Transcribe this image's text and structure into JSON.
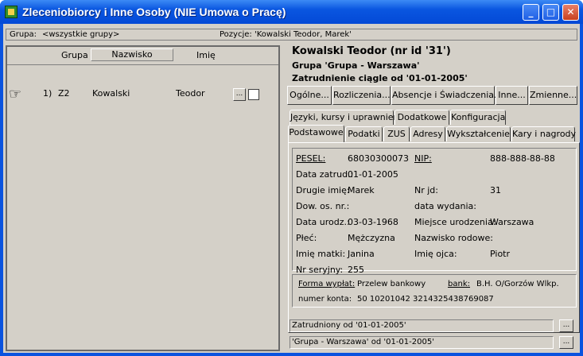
{
  "window": {
    "title": "Zleceniobiorcy i Inne Osoby (NIE Umowa o Pracę)",
    "min_label": "_",
    "max_label": "□",
    "close_label": "✕"
  },
  "groupbar": {
    "group_label": "Grupa:",
    "group_value": "<wszystkie grupy>",
    "position_label": "Pozycje:",
    "position_value": "'Kowalski Teodor, Marek'"
  },
  "list": {
    "col_group": "Grupa",
    "col_surname": "Nazwisko",
    "col_name": "Imię",
    "rows": [
      {
        "num": "1)",
        "group": "Z2",
        "surname": "Kowalski",
        "name": "Teodor",
        "dots": "..."
      }
    ]
  },
  "detail": {
    "header_name": "Kowalski Teodor (nr id '31')",
    "header_group": "Grupa 'Grupa - Warszawa'",
    "header_employment": "Zatrudnienie ciągle od '01-01-2005'"
  },
  "buttons": {
    "ogolne": "Ogólne...",
    "rozliczenia": "Rozliczenia...",
    "absencje": "Absencje i Świadczenia...",
    "inne": "Inne...",
    "zmienne": "Zmienne..."
  },
  "tabs": {
    "row1": [
      "Języki, kursy i uprawnienia",
      "Dodatkowe",
      "Konfiguracja"
    ],
    "row2": [
      "Podstawowe",
      "Podatki",
      "ZUS",
      "Adresy",
      "Wykształcenie",
      "Kary i nagrody"
    ]
  },
  "fields": {
    "pesel_label": "PESEL:",
    "pesel": "68030300073",
    "nip_label": "NIP:",
    "nip": "888-888-88-88",
    "data_zatrud_label": "Data zatrud.:",
    "data_zatrud": "01-01-2005",
    "drugie_imie_label": "Drugie imię:",
    "drugie_imie": "Marek",
    "nr_jd_label": "Nr jd:",
    "nr_jd": "31",
    "dow_label": "Dow. os. nr.:",
    "dow": "",
    "data_wydania_label": "data wydania:",
    "data_wydania": "",
    "data_urodz_label": "Data urodz.:",
    "data_urodz": "03-03-1968",
    "miejsce_label": "Miejsce urodzenia:",
    "miejsce": "Warszawa",
    "plec_label": "Płeć:",
    "plec": "Mężczyzna",
    "nazwisko_rod_label": "Nazwisko rodowe:",
    "nazwisko_rod": "",
    "imie_matki_label": "Imię matki:",
    "imie_matki": "Janina",
    "imie_ojca_label": "Imię ojca:",
    "imie_ojca": "Piotr",
    "nr_seryjny_label": "Nr seryjny:",
    "nr_seryjny": "255",
    "forma_label": "Forma wypłat:",
    "forma": "Przelew bankowy",
    "bank_label": "bank:",
    "bank": "B.H. O/Gorzów Wlkp.",
    "konto_label": "numer konta:",
    "konto": "50 10201042 3214325438769087"
  },
  "status": {
    "line1": "Zatrudniony od '01-01-2005'",
    "line2": "'Grupa - Warszawa' od '01-01-2005'",
    "dots": "..."
  }
}
